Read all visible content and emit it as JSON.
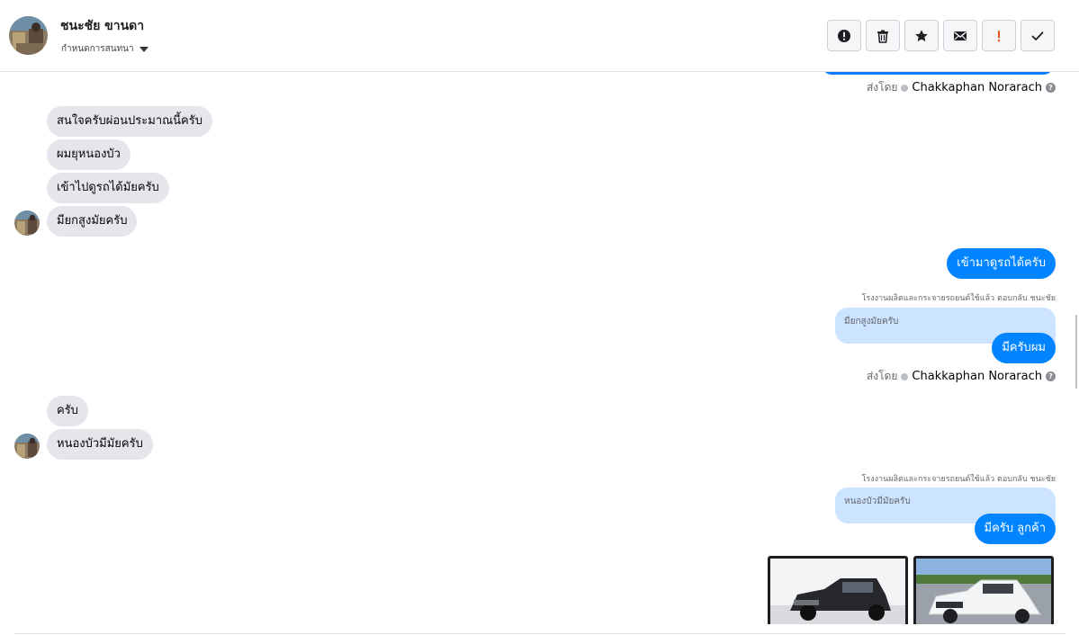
{
  "header": {
    "contact_name": "ชนะชัย ขานดา",
    "subtitle": "กำหนดการสนทนา",
    "actions": [
      {
        "name": "report-button",
        "icon": "alert-circle-icon"
      },
      {
        "name": "delete-button",
        "icon": "trash-icon"
      },
      {
        "name": "star-button",
        "icon": "star-icon"
      },
      {
        "name": "mark-unread-button",
        "icon": "envelope-icon"
      },
      {
        "name": "priority-button",
        "icon": "exclamation-icon"
      },
      {
        "name": "done-button",
        "icon": "check-icon"
      }
    ]
  },
  "conversation": {
    "sent_by_label": "ส่งโดย",
    "sender_name": "Chakkaphan Norarach",
    "help_glyph": "?",
    "incoming_group_1": [
      "สนใจครับผ่อนประมาณนี้ครับ",
      "ผมยุหนองบัว",
      "เข้าไปดูรถได้มัยครับ",
      "มียกสูงมัยครับ"
    ],
    "outgoing_1": "เข้ามาดูรถได้ครับ",
    "reply_note_1": "โรงงานผลิตและกระจายรถยนต์ใช้แล้ว ตอบกลับ ชนะชัย",
    "quoted_1": "มียกสูงมัยครับ",
    "outgoing_2": "มีครับผม",
    "incoming_group_2": [
      "ครับ",
      "หนองบัวมีมัยครับ"
    ],
    "reply_note_2": "โรงงานผลิตและกระจายรถยนต์ใช้แล้ว ตอบกลับ ชนะชัย",
    "quoted_2": "หนองบัวมีมัยครับ",
    "outgoing_3": "มีครับ ลูกค้า"
  },
  "colors": {
    "outgoing_bubble": "#0084ff",
    "incoming_bubble": "#e4e6eb",
    "quoted_bubble": "#cce4ff",
    "priority_icon": "#e4511b"
  }
}
